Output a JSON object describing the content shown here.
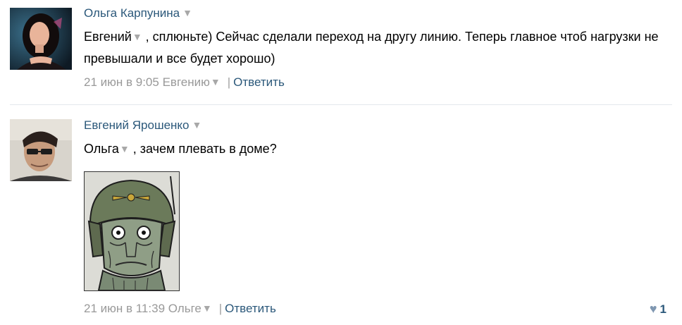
{
  "comments": [
    {
      "author": "Ольга Карпунина",
      "mention": "Евгений",
      "text_after_mention": " , сплюньте) Сейчас сделали переход на другу линию. Теперь главное чтоб нагрузки не превышали и все будет хорошо)",
      "timestamp": "21 июн в 9:05",
      "reply_to": "Евгению",
      "reply_label": "Ответить",
      "dropdown_icon": "triangle-down-icon"
    },
    {
      "author": "Евгений Ярошенко",
      "mention": "Ольга",
      "text_after_mention": " , зачем плевать в доме?",
      "timestamp": "21 июн в 11:39",
      "reply_to": "Ольге",
      "reply_label": "Ответить",
      "likes": "1",
      "like_icon": "heart-icon",
      "dropdown_icon": "triangle-down-icon"
    }
  ],
  "colors": {
    "link": "#2b587a",
    "meta": "#999999",
    "divider": "#e4e8ec"
  }
}
